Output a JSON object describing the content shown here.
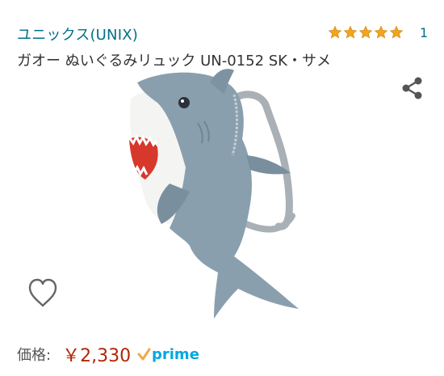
{
  "product": {
    "brand": "ユニックス(UNIX)",
    "title": "ガオー ぬいぐるみリュック UN-0152 SK・サメ",
    "rating": {
      "stars": 5,
      "max_stars": 5,
      "count": "1",
      "star_color": "#f2a41c"
    },
    "image": {
      "icon": "shark-plush-backpack"
    },
    "price": {
      "label": "価格:",
      "value": "￥2,330",
      "color": "#b12704"
    },
    "prime": {
      "label": "prime",
      "color": "#00a8e1"
    }
  },
  "actions": {
    "share_icon": "share-icon",
    "wishlist_icon": "heart-outline-icon"
  }
}
